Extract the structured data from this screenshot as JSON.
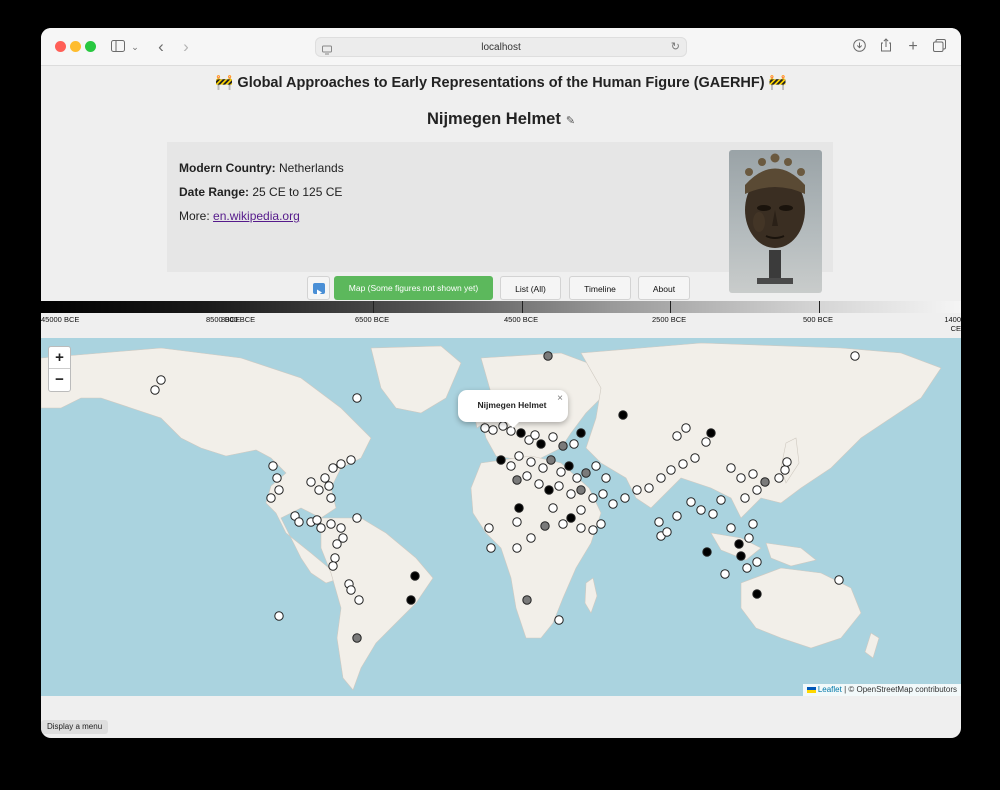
{
  "browser": {
    "url": "localhost",
    "icons": [
      "sidebar-icon",
      "chevron-down-icon",
      "back-icon",
      "forward-icon",
      "site-icon",
      "reload-icon",
      "download-icon",
      "share-icon",
      "new-tab-icon",
      "tabs-icon"
    ]
  },
  "header": {
    "app_title": "🚧 Global Approaches to Early Representations of the Human Figure (GAERHF) 🚧",
    "figure_title": "Nijmegen Helmet",
    "edit_icon": "✎"
  },
  "info": {
    "country_label": "Modern Country:",
    "country_value": "Netherlands",
    "date_label": "Date Range:",
    "date_value": "25 CE to 125 CE",
    "more_label": "More:",
    "more_link": "en.wikipedia.org"
  },
  "nav": {
    "play_icon": "play-icon",
    "map_label": "Map (Some figures not shown yet)",
    "list_label": "List (All)",
    "timeline_label": "Timeline",
    "about_label": "About",
    "active_color": "#5cb85c"
  },
  "timeline": {
    "labels": [
      "45000 BCE",
      "8500 BCE",
      "8000 BCE",
      "6500 BCE",
      "4500 BCE",
      "2500 BCE",
      "500 BCE",
      "1400 CE"
    ]
  },
  "map": {
    "zoom_in": "+",
    "zoom_out": "−",
    "popup_title": "Nijmegen Helmet",
    "popup_close": "×",
    "attribution_leaflet": "Leaflet",
    "attribution_rest": "| © OpenStreetMap contributors",
    "colors": {
      "water": "#aad3df",
      "land": "#f2efe9",
      "marker_dark": "#000000",
      "marker_mid": "#7a7a7a",
      "marker_light": "#ffffff"
    }
  },
  "footer": {
    "menu_label": "Display a menu"
  }
}
